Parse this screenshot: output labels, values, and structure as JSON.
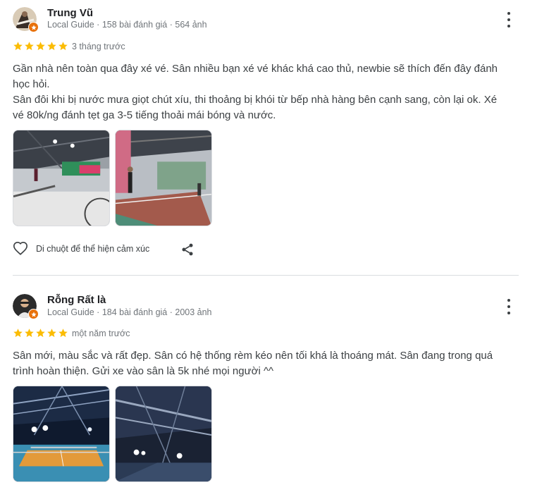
{
  "reviews": [
    {
      "name": "Trung Vũ",
      "meta": "Local Guide · 158 bài đánh giá · 564 ảnh",
      "rating": 5,
      "time": "3 tháng trước",
      "lines": [
        "Gần nhà nên toàn qua đây xé vé. Sân nhiều bạn xé vé khác khá cao thủ, newbie sẽ thích đến đây đánh",
        "học hỏi.",
        "Sân đôi khi bị nước mưa giọt chút xíu, thi thoảng bị khói từ bếp nhà hàng bên cạnh sang, còn lại ok. Xé",
        "vé 80k/ng đánh tẹt ga 3-5 tiếng thoải mái bóng và nước."
      ],
      "react_label": "Di chuột để thể hiện cảm xúc"
    },
    {
      "name": "Rỗng Rất là",
      "meta": "Local Guide · 184 bài đánh giá · 2003 ảnh",
      "rating": 5,
      "time": "một năm trước",
      "lines": [
        "Sân mới, màu sắc và rất đẹp. Sân có hệ thống rèm kéo nên tối khá là thoáng mát. Sân đang trong quá",
        "trình hoàn thiện. Gửi xe vào sân là 5k nhé mọi người ^^"
      ]
    }
  ],
  "icons": {
    "star": "star-icon",
    "more": "more-vert-icon",
    "heart": "heart-icon",
    "share": "share-icon",
    "badge": "local-guide-badge-icon"
  },
  "colors": {
    "star": "#fbbc04",
    "text": "#3c4043",
    "meta": "#70757a",
    "badge": "#e8710a"
  }
}
